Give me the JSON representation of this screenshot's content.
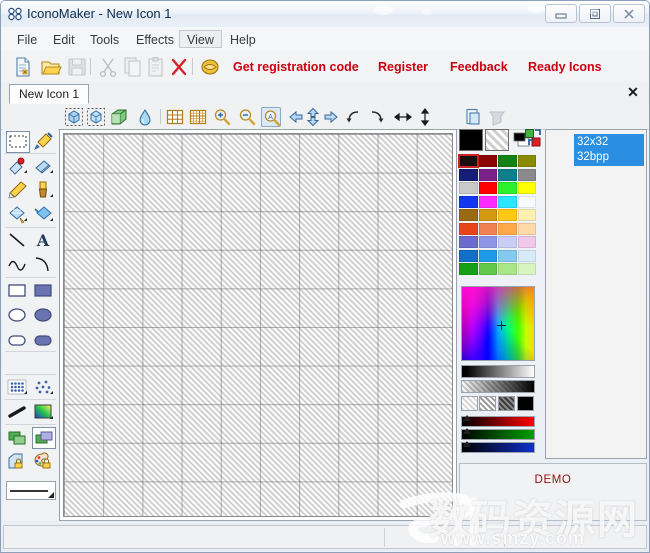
{
  "window": {
    "title": "IconoMaker - New Icon 1",
    "icon": "app-icon",
    "controls": [
      {
        "name": "minimize-button",
        "glyph": "minimize-icon"
      },
      {
        "name": "maximize-button",
        "glyph": "maximize-icon"
      },
      {
        "name": "close-button",
        "glyph": "close-icon"
      }
    ]
  },
  "menubar": {
    "items": [
      {
        "label": "File",
        "active": false
      },
      {
        "label": "Edit",
        "active": false
      },
      {
        "label": "Tools",
        "active": false
      },
      {
        "label": "Effects",
        "active": false
      },
      {
        "label": "View",
        "active": true
      },
      {
        "label": "Help",
        "active": false
      }
    ]
  },
  "toolbar": {
    "buttons": [
      {
        "name": "new-icon-button",
        "icon": "new-document-icon",
        "enabled": true
      },
      {
        "name": "open-button",
        "icon": "open-folder-icon",
        "enabled": true
      },
      {
        "name": "save-button",
        "icon": "save-disk-icon",
        "enabled": false
      },
      {
        "name": "cut-button",
        "icon": "scissors-icon",
        "enabled": false
      },
      {
        "name": "copy-button",
        "icon": "copy-icon",
        "enabled": false
      },
      {
        "name": "paste-button",
        "icon": "paste-icon",
        "enabled": false
      },
      {
        "name": "delete-button",
        "icon": "red-x-icon",
        "enabled": true
      },
      {
        "name": "about-button",
        "icon": "gold-tag-icon",
        "enabled": true
      }
    ],
    "links": [
      {
        "label": "Get registration code",
        "name": "get-registration-code-link"
      },
      {
        "label": "Register",
        "name": "register-link"
      },
      {
        "label": "Feedback",
        "name": "feedback-link"
      },
      {
        "label": "Ready Icons",
        "name": "ready-icons-link"
      }
    ],
    "link_color": "#cc0011"
  },
  "tabs": {
    "items": [
      {
        "label": "New Icon 1",
        "active": true
      }
    ],
    "close_glyph": "✕"
  },
  "viewbar": {
    "buttons": [
      {
        "name": "image-3d-1-button",
        "icon": "cube-select-icon",
        "selected": false
      },
      {
        "name": "image-3d-2-button",
        "icon": "cube-select-alt-icon",
        "selected": false
      },
      {
        "name": "image-depth-button",
        "icon": "green-cube-icon",
        "selected": false
      },
      {
        "name": "transparency-button",
        "icon": "water-drop-icon",
        "selected": false
      },
      {
        "name": "grid-toggle-button",
        "icon": "grid-icon",
        "selected": false
      },
      {
        "name": "grid-fine-button",
        "icon": "fine-grid-icon",
        "selected": false
      },
      {
        "name": "zoom-in-button",
        "icon": "magnifier-plus-icon",
        "selected": false
      },
      {
        "name": "zoom-out-button",
        "icon": "magnifier-minus-icon",
        "selected": false
      },
      {
        "name": "zoom-fit-button",
        "icon": "magnifier-auto-icon",
        "selected": true
      },
      {
        "name": "shift-left-button",
        "icon": "arrow-left-icon",
        "selected": false
      },
      {
        "name": "shift-vertical-button",
        "icon": "arrow-up-down-icon",
        "selected": false
      },
      {
        "name": "shift-right-button",
        "icon": "arrow-right-icon",
        "selected": false
      },
      {
        "name": "rotate-left-button",
        "icon": "rotate-ccw-icon",
        "selected": false
      },
      {
        "name": "rotate-right-button",
        "icon": "rotate-cw-icon",
        "selected": false
      },
      {
        "name": "flip-horizontal-button",
        "icon": "flip-horizontal-icon",
        "selected": false
      },
      {
        "name": "flip-vertical-button",
        "icon": "flip-vertical-icon",
        "selected": false
      }
    ],
    "right_buttons": [
      {
        "name": "add-image-button",
        "icon": "add-image-icon",
        "enabled": true
      },
      {
        "name": "delete-image-button",
        "icon": "delete-image-icon",
        "enabled": false
      }
    ]
  },
  "toolpalette": {
    "tools": [
      {
        "name": "rect-select-tool",
        "icon": "marquee-icon",
        "selected": true
      },
      {
        "name": "color-picker-tool",
        "icon": "eyedropper-icon",
        "selected": false
      },
      {
        "name": "eraser-tool",
        "icon": "eraser-pin-icon",
        "selected": false
      },
      {
        "name": "soft-eraser-tool",
        "icon": "blue-eraser-icon",
        "selected": false
      },
      {
        "name": "pencil-tool",
        "icon": "pencil-icon",
        "selected": false
      },
      {
        "name": "brush-tool",
        "icon": "paint-brush-icon",
        "selected": false
      },
      {
        "name": "pattern-fill-tool",
        "icon": "pattern-bucket-icon",
        "selected": false
      },
      {
        "name": "fill-tool",
        "icon": "paint-bucket-icon",
        "selected": false
      },
      {
        "name": "line-tool",
        "icon": "line-icon",
        "selected": false
      },
      {
        "name": "text-tool",
        "icon": "text-a-icon",
        "selected": false
      },
      {
        "name": "curve-tool",
        "icon": "wave-curve-icon",
        "selected": false
      },
      {
        "name": "arc-tool",
        "icon": "arc-icon",
        "selected": false
      },
      {
        "name": "rectangle-tool",
        "icon": "rectangle-outline-icon",
        "selected": false
      },
      {
        "name": "filled-rectangle-tool",
        "icon": "rectangle-filled-icon",
        "selected": false
      },
      {
        "name": "ellipse-tool",
        "icon": "ellipse-outline-icon",
        "selected": false
      },
      {
        "name": "filled-ellipse-tool",
        "icon": "ellipse-filled-icon",
        "selected": false
      },
      {
        "name": "rounded-rect-tool",
        "icon": "rounded-rect-outline-icon",
        "selected": false
      },
      {
        "name": "filled-rounded-rect-tool",
        "icon": "rounded-rect-filled-icon",
        "selected": false
      }
    ],
    "line_width": {
      "name": "line-width-selector",
      "icon": "line-width-icon"
    },
    "extras": [
      {
        "name": "dither-pattern-tool",
        "icon": "dense-dither-icon",
        "selected": false
      },
      {
        "name": "spray-pattern-tool",
        "icon": "sparse-dither-icon",
        "selected": false
      },
      {
        "name": "smudge-tool",
        "icon": "smudge-bar-icon",
        "selected": false
      },
      {
        "name": "gradient-tool",
        "icon": "gradient-square-icon",
        "selected": false
      },
      {
        "name": "layer-back-tool",
        "icon": "layers-green-icon",
        "selected": false
      },
      {
        "name": "layer-front-tool",
        "icon": "layers-purple-icon",
        "selected": true
      },
      {
        "name": "lock-image-tool",
        "icon": "lock-box-icon",
        "selected": false
      },
      {
        "name": "lock-color-tool",
        "icon": "lock-palette-icon",
        "selected": false
      }
    ]
  },
  "colors": {
    "foreground": "#000000",
    "background": "transparent",
    "preview_fg": "#000000",
    "preview_bg": "#ffffff",
    "swatch_green": "#3fb53f",
    "swatch_red": "#e02020",
    "selected_index": 0,
    "palette": [
      "#1a0f0f",
      "#8b0000",
      "#138113",
      "#8a8a00",
      "#141e78",
      "#7b1f8a",
      "#0f7e8c",
      "#8a8a8a",
      "#c9c9c9",
      "#ff0000",
      "#2bf02b",
      "#ffff00",
      "#1038f0",
      "#ff2bff",
      "#2be6ff",
      "#f7fbff",
      "#9a6a10",
      "#d49a10",
      "#ffc812",
      "#fff0b0",
      "#e8441a",
      "#f08156",
      "#ffa84a",
      "#ffd9a8",
      "#6a6ad0",
      "#8f96e8",
      "#c8cef5",
      "#f0c8ea",
      "#1070c8",
      "#1f9ae8",
      "#87c8f0",
      "#d8ecf8",
      "#16a016",
      "#62c84a",
      "#a8e68a",
      "#d8f5c0"
    ],
    "patterns": [
      "light-hatch",
      "medium-hatch",
      "dark-hatch",
      "solid-black"
    ],
    "sliders": [
      {
        "name": "red-slider",
        "color": "#ff0000",
        "value": 0
      },
      {
        "name": "green-slider",
        "color": "#00a000",
        "value": 0
      },
      {
        "name": "blue-slider",
        "color": "#1030c8",
        "value": 0
      }
    ]
  },
  "imagelist": {
    "items": [
      {
        "size": "32x32",
        "depth": "32bpp",
        "selected": true
      }
    ]
  },
  "demo": {
    "label": "DEMO",
    "color": "#8d1313"
  },
  "statusbar": {
    "left": "",
    "middle": "",
    "right": ""
  },
  "watermark": {
    "site_cn": "数码资源网",
    "site_url": "www.smzy.com",
    "logo": "smzy-logo"
  }
}
